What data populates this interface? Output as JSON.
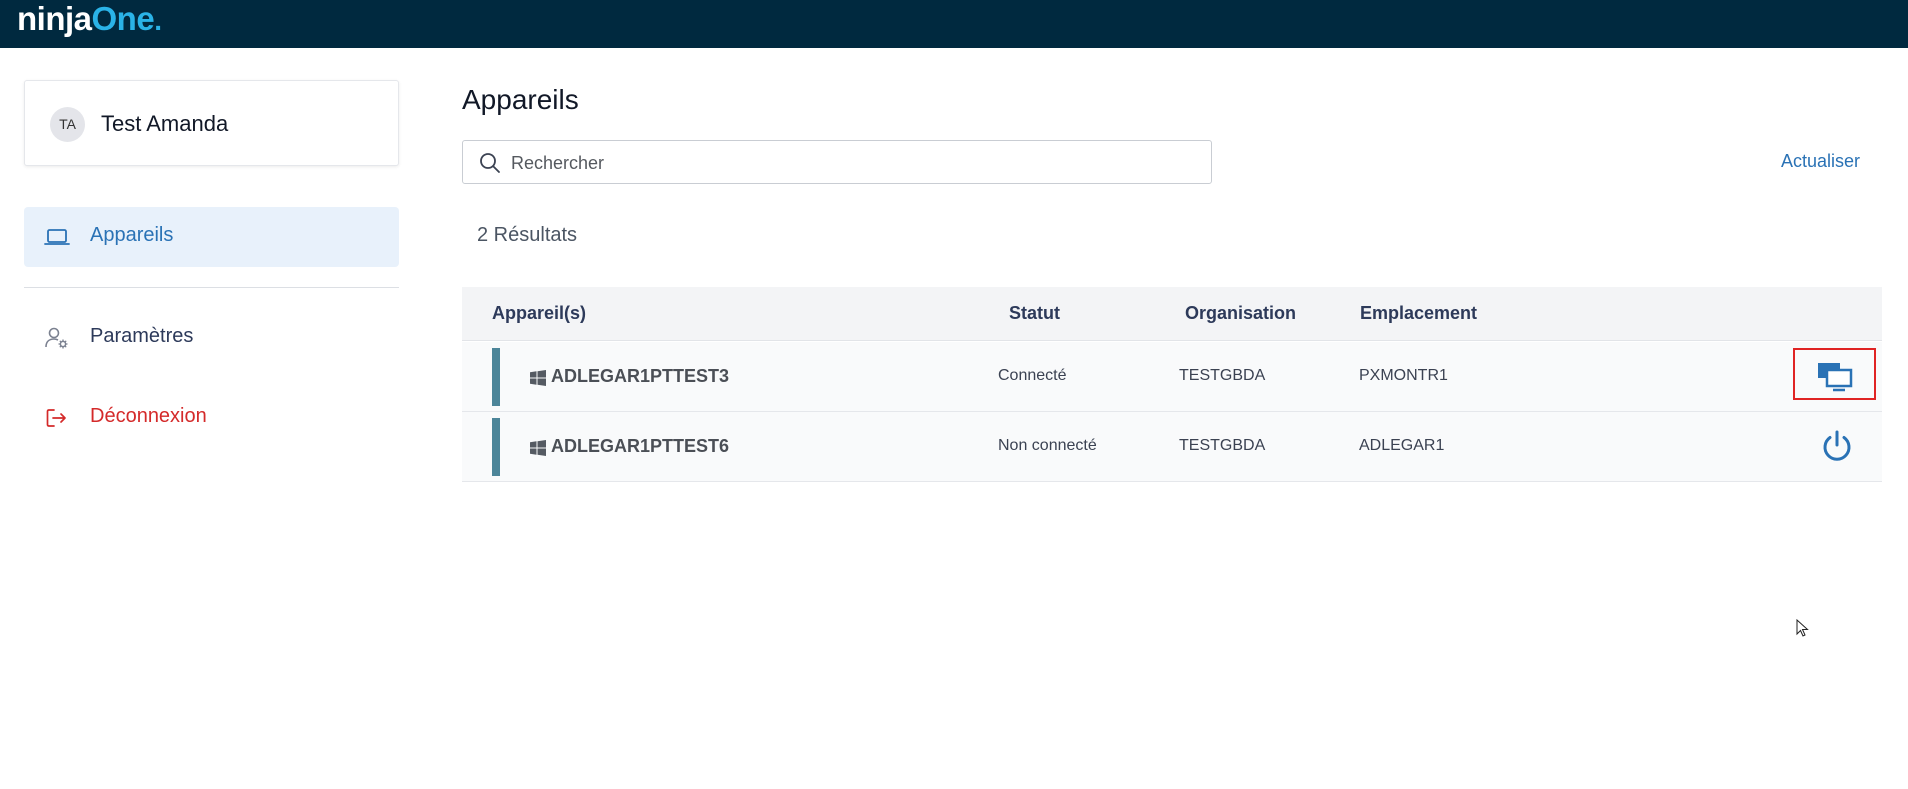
{
  "app": {
    "logo_main": "ninja",
    "logo_accent": "One",
    "logo_dot": "."
  },
  "user": {
    "initials": "TA",
    "name": "Test Amanda"
  },
  "sidebar": {
    "items": [
      {
        "label": "Appareils",
        "icon": "laptop-icon",
        "active": true
      },
      {
        "label": "Paramètres",
        "icon": "user-settings-icon",
        "active": false
      },
      {
        "label": "Déconnexion",
        "icon": "logout-icon",
        "active": false
      }
    ]
  },
  "main": {
    "title": "Appareils",
    "search_placeholder": "Rechercher",
    "search_value": "",
    "refresh_label": "Actualiser",
    "results_label": "2 Résultats"
  },
  "table": {
    "columns": [
      "Appareil(s)",
      "Statut",
      "Organisation",
      "Emplacement"
    ],
    "rows": [
      {
        "device": "ADLEGAR1PTTEST3",
        "status": "Connecté",
        "organization": "TESTGBDA",
        "location": "PXMONTR1",
        "action": "remote-control-icon"
      },
      {
        "device": "ADLEGAR1PTTEST6",
        "status": "Non connecté",
        "organization": "TESTGBDA",
        "location": "ADLEGAR1",
        "action": "power-icon"
      }
    ]
  },
  "colors": {
    "topbar": "#00293f",
    "accent": "#2a72b5",
    "logout": "#d42a2a",
    "status_bar": "#4c8599",
    "highlight": "#e02424"
  }
}
